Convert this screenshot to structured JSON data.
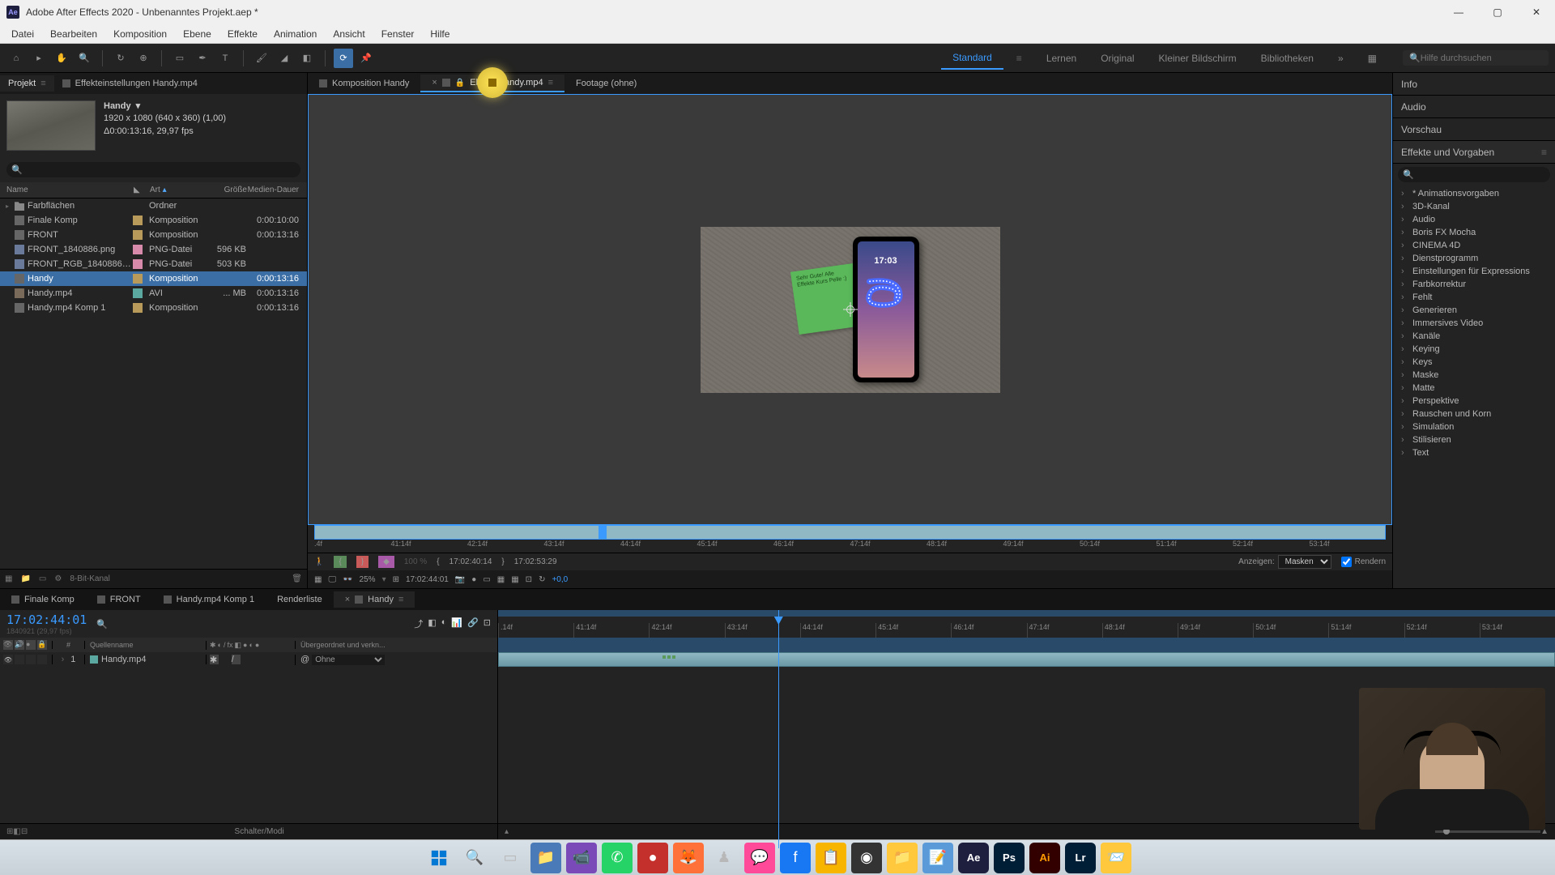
{
  "window": {
    "title": "Adobe After Effects 2020 - Unbenanntes Projekt.aep *"
  },
  "menu": {
    "file": "Datei",
    "edit": "Bearbeiten",
    "composition": "Komposition",
    "layer": "Ebene",
    "effect": "Effekte",
    "animation": "Animation",
    "view": "Ansicht",
    "window": "Fenster",
    "help": "Hilfe"
  },
  "workspaces": {
    "standard": "Standard",
    "learn": "Lernen",
    "original": "Original",
    "small": "Kleiner Bildschirm",
    "libraries": "Bibliotheken"
  },
  "search": {
    "placeholder": "Hilfe durchsuchen"
  },
  "project": {
    "tab_project": "Projekt",
    "tab_effects": "Effekteinstellungen  Handy.mp4",
    "selected_name": "Handy",
    "meta_line1": "1920 x 1080 (640 x 360) (1,00)",
    "meta_line2": "Δ0:00:13:16, 29,97 fps",
    "columns": {
      "name": "Name",
      "art": "Art",
      "size": "Größe",
      "dauer": "Medien-Dauer"
    },
    "items": [
      {
        "name": "Farbflächen",
        "art": "Ordner",
        "size": "",
        "dauer": "",
        "icon": "folder",
        "label": ""
      },
      {
        "name": "Finale Komp",
        "art": "Komposition",
        "size": "",
        "dauer": "0:00:10:00",
        "icon": "comp",
        "label": "gold"
      },
      {
        "name": "FRONT",
        "art": "Komposition",
        "size": "",
        "dauer": "0:00:13:16",
        "icon": "comp",
        "label": "gold"
      },
      {
        "name": "FRONT_1840886.png",
        "art": "PNG-Datei",
        "size": "596 KB",
        "dauer": "",
        "icon": "img",
        "label": "pink"
      },
      {
        "name": "FRONT_RGB_1840886.png",
        "art": "PNG-Datei",
        "size": "503 KB",
        "dauer": "",
        "icon": "img",
        "label": "pink"
      },
      {
        "name": "Handy",
        "art": "Komposition",
        "size": "",
        "dauer": "0:00:13:16",
        "icon": "comp",
        "label": "gold",
        "selected": true
      },
      {
        "name": "Handy.mp4",
        "art": "AVI",
        "size": "... MB",
        "dauer": "0:00:13:16",
        "icon": "vid",
        "label": "teal"
      },
      {
        "name": "Handy.mp4 Komp 1",
        "art": "Komposition",
        "size": "",
        "dauer": "0:00:13:16",
        "icon": "comp",
        "label": "gold"
      }
    ],
    "footer": {
      "bpc": "8-Bit-Kanal"
    }
  },
  "viewer": {
    "tab_comp": "Komposition  Handy",
    "tab_layer": "Ebene Handy.mp4",
    "tab_footage": "Footage  (ohne)",
    "phone_time": "17:03",
    "note_text": "Sehr Gute!\nAlle Effekte\nKurs Pelle :)",
    "ruler_ticks": [
      ".4f",
      "41:14f",
      "42:14f",
      "43:14f",
      "44:14f",
      "45:14f",
      "46:14f",
      "47:14f",
      "48:14f",
      "49:14f",
      "50:14f",
      "51:14f",
      "52:14f",
      "53:14f"
    ],
    "status": {
      "in": "17:02:40:14",
      "out": "17:02:53:29",
      "anzeigen_label": "Anzeigen:",
      "anzeigen_value": "Masken",
      "render": "Rendern"
    },
    "bottom": {
      "zoom": "25%",
      "timecode": "17:02:44:01",
      "exposure": "+0,0"
    }
  },
  "right": {
    "info": "Info",
    "audio": "Audio",
    "preview": "Vorschau",
    "presets": "Effekte und Vorgaben",
    "items": [
      "* Animationsvorgaben",
      "3D-Kanal",
      "Audio",
      "Boris FX Mocha",
      "CINEMA 4D",
      "Dienstprogramm",
      "Einstellungen für Expressions",
      "Farbkorrektur",
      "Fehlt",
      "Generieren",
      "Immersives Video",
      "Kanäle",
      "Keying",
      "Keys",
      "Maske",
      "Matte",
      "Perspektive",
      "Rauschen und Korn",
      "Simulation",
      "Stilisieren",
      "Text"
    ]
  },
  "timeline": {
    "tabs": {
      "finale": "Finale Komp",
      "front": "FRONT",
      "komp1": "Handy.mp4 Komp 1",
      "render": "Renderliste",
      "handy": "Handy"
    },
    "timecode": "17:02:44:01",
    "fps_hint": "1840921 (29,97 fps)",
    "col_source": "Quellenname",
    "col_parent": "Übergeordnet und verkn...",
    "layer": {
      "index": "1",
      "name": "Handy.mp4",
      "parent": "Ohne"
    },
    "ruler": [
      ".14f",
      "41:14f",
      "42:14f",
      "43:14f",
      "44:14f",
      "45:14f",
      "46:14f",
      "47:14f",
      "48:14f",
      "49:14f",
      "50:14f",
      "51:14f",
      "52:14f",
      "53:14f"
    ],
    "schalter": "Schalter/Modi"
  },
  "colors": {
    "accent": "#3a9aff",
    "gold": "#b89a5a",
    "pink": "#d88aaa",
    "teal": "#5aa8a0"
  }
}
